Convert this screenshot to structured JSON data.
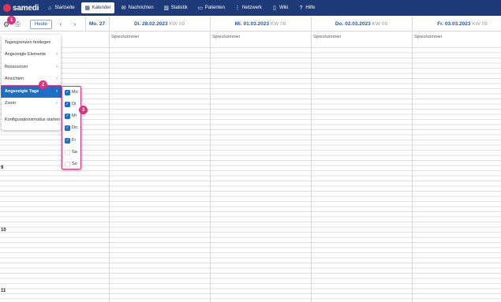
{
  "app": {
    "logo_text": "samedi"
  },
  "nav": [
    {
      "label": "Startseite",
      "icon": "home-icon",
      "glyph": "⌂",
      "active": false
    },
    {
      "label": "Kalender",
      "icon": "calendar-icon",
      "glyph": "▦",
      "active": true
    },
    {
      "label": "Nachrichten",
      "icon": "mail-icon",
      "glyph": "✉",
      "active": false
    },
    {
      "label": "Statistik",
      "icon": "chart-icon",
      "glyph": "▥",
      "active": false
    },
    {
      "label": "Patienten",
      "icon": "patient-card-icon",
      "glyph": "▭",
      "active": false
    },
    {
      "label": "Netzwerk",
      "icon": "network-icon",
      "glyph": "⋮",
      "active": false
    },
    {
      "label": "Wiki",
      "icon": "book-icon",
      "glyph": "▯",
      "active": false
    },
    {
      "label": "Hilfe",
      "icon": "help-icon",
      "glyph": "?",
      "active": false
    }
  ],
  "toolbar": {
    "today_label": "Heute",
    "prev_glyph": "‹",
    "next_glyph": "›"
  },
  "days": [
    {
      "label": "Mo. 27",
      "kw": ""
    },
    {
      "label": "Di. 28.02.2023",
      "kw": "KW 09"
    },
    {
      "label": "Mi. 01.03.2023",
      "kw": "KW 09"
    },
    {
      "label": "Do. 02.03.2023",
      "kw": "KW 09"
    },
    {
      "label": "Fr. 03.03.2023",
      "kw": "KW 09"
    }
  ],
  "column_subheader": "Sprechzimmer",
  "hours": [
    "9",
    "10",
    "11"
  ],
  "menu": {
    "items": [
      {
        "label": "Tagesgrenzen festlegen",
        "chevron": false,
        "active": false
      },
      {
        "label": "Angezeigte Elemente",
        "chevron": true,
        "active": false
      },
      {
        "label": "Ressourcen",
        "chevron": true,
        "active": false
      },
      {
        "label": "Ansichten",
        "chevron": true,
        "active": false
      },
      {
        "label": "Angezeigte Tage",
        "chevron": true,
        "active": true
      },
      {
        "label": "Zoom",
        "chevron": true,
        "active": false
      },
      {
        "label": "Konfigurationsmodus starten",
        "chevron": false,
        "active": false
      }
    ]
  },
  "days_submenu": [
    {
      "label": "Mo",
      "checked": true
    },
    {
      "label": "Di",
      "checked": true
    },
    {
      "label": "Mi",
      "checked": true
    },
    {
      "label": "Do",
      "checked": true
    },
    {
      "label": "Fr",
      "checked": true
    },
    {
      "label": "Sa",
      "checked": false
    },
    {
      "label": "So",
      "checked": false
    }
  ],
  "badges": [
    "1",
    "2",
    "3"
  ],
  "colors": {
    "navbar": "#1e3a78",
    "accent": "#1e6fc4",
    "badge": "#e0307a",
    "logo": "#e5304f"
  }
}
